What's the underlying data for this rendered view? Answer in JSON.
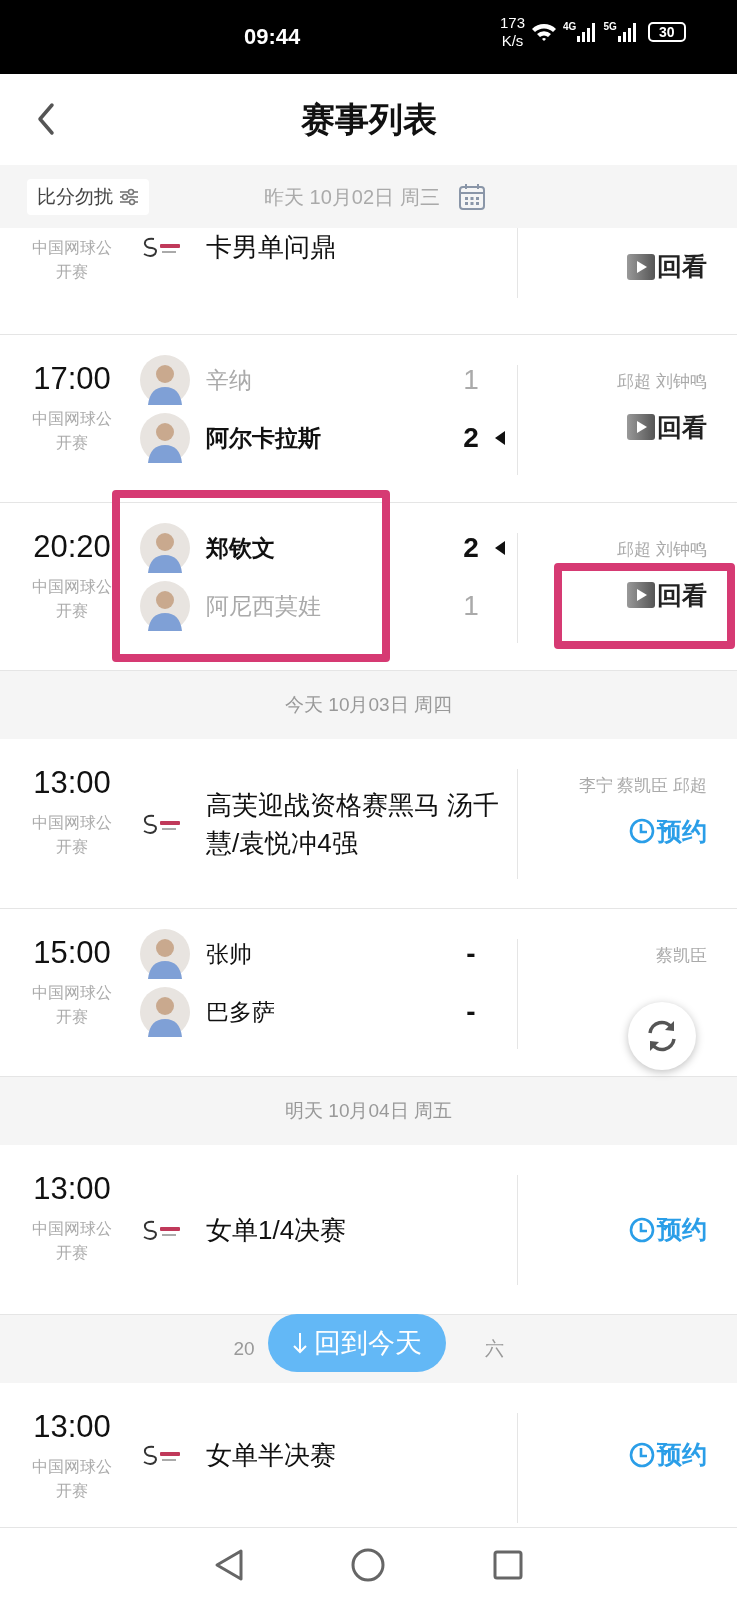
{
  "status_bar": {
    "time": "09:44",
    "speed_value": "173",
    "speed_unit": "K/s",
    "network_1": "4G",
    "network_2": "5G",
    "battery": "30"
  },
  "header": {
    "title": "赛事列表"
  },
  "date_bar": {
    "filter_label": "比分勿扰",
    "label": "昨天 10月02日 周三"
  },
  "items": [
    {
      "kind": "event",
      "partial": true,
      "tournament": "中国网球公开赛",
      "title": "卡男单问鼎",
      "action": {
        "kind": "replay",
        "label": "回看"
      }
    },
    {
      "kind": "match",
      "time": "17:00",
      "tournament": "中国网球公开赛",
      "players": [
        {
          "name": "辛纳",
          "score": "1",
          "winner": false
        },
        {
          "name": "阿尔卡拉斯",
          "score": "2",
          "winner": true
        }
      ],
      "commentators": "邱超 刘钟鸣",
      "action": {
        "kind": "replay",
        "label": "回看"
      }
    },
    {
      "kind": "match",
      "time": "20:20",
      "tournament": "中国网球公开赛",
      "players": [
        {
          "name": "郑钦文",
          "score": "2",
          "winner": true
        },
        {
          "name": "阿尼西莫娃",
          "score": "1",
          "winner": false
        }
      ],
      "commentators": "邱超 刘钟鸣",
      "action": {
        "kind": "replay",
        "label": "回看"
      },
      "highlighted": true
    },
    {
      "kind": "day",
      "parts": [
        "今天 10月03日 周四"
      ]
    },
    {
      "kind": "event",
      "time": "13:00",
      "tournament": "中国网球公开赛",
      "title": "高芙迎战资格赛黑马 汤千慧/袁悦冲4强",
      "commentators": "李宁 蔡凯臣 邱超",
      "action": {
        "kind": "reserve",
        "label": "预约"
      }
    },
    {
      "kind": "match",
      "time": "15:00",
      "tournament": "中国网球公开赛",
      "players": [
        {
          "name": "张帅",
          "score": "-",
          "winner": false
        },
        {
          "name": "巴多萨",
          "score": "-",
          "winner": false
        }
      ],
      "commentators": "蔡凯臣"
    },
    {
      "kind": "day",
      "parts": [
        "明天 10月04日 周五"
      ]
    },
    {
      "kind": "event",
      "time": "13:00",
      "tournament": "中国网球公开赛",
      "title": "女单1/4决赛",
      "action": {
        "kind": "reserve",
        "label": "预约"
      }
    },
    {
      "kind": "day",
      "parts": [
        "20",
        "六"
      ],
      "today_button": "回到今天"
    },
    {
      "kind": "event",
      "time": "13:00",
      "tournament": "中国网球公开赛",
      "title": "女单半决赛",
      "action": {
        "kind": "reserve",
        "label": "预约"
      },
      "last": true
    }
  ]
}
